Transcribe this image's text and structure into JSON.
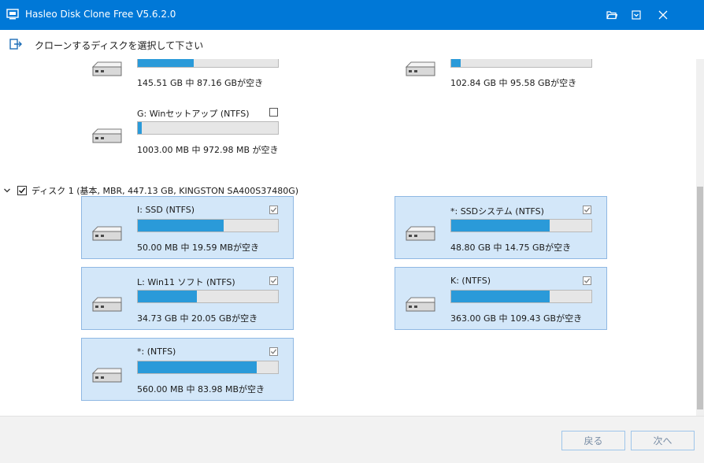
{
  "window": {
    "title": "Hasleo Disk Clone Free V5.6.2.0",
    "accent": "#0078d7",
    "icons": [
      "app-icon",
      "open-folder-icon",
      "menu-icon",
      "close-icon"
    ]
  },
  "toolbar": {
    "back_icon": "exit-icon",
    "title": "クローンするディスクを選択して下さい"
  },
  "partitions_top": [
    {
      "name": "",
      "capacity": "145.51 GB 中 87.16 GBが空き",
      "used_fraction": 0.4,
      "checked": false
    },
    {
      "name": "",
      "capacity": "102.84 GB 中 95.58 GBが空き",
      "used_fraction": 0.07,
      "checked": false
    },
    {
      "name": "G: Winセットアップ (NTFS)",
      "capacity": "1003.00 MB 中 972.98 MB が空き",
      "used_fraction": 0.03,
      "checked": false
    }
  ],
  "disk1": {
    "label": "ディスク 1 (基本, MBR, 447.13 GB,  KINGSTON SA400S37480G)",
    "checked": true,
    "partitions": [
      {
        "name": "I: SSD (NTFS)",
        "capacity": "50.00 MB 中 19.59 MBが空き",
        "used_fraction": 0.61,
        "checked": true
      },
      {
        "name": "*: SSDシステム (NTFS)",
        "capacity": "48.80 GB 中 14.75 GBが空き",
        "used_fraction": 0.7,
        "checked": true
      },
      {
        "name": "L: Win11 ソフト (NTFS)",
        "capacity": "34.73 GB 中 20.05 GBが空き",
        "used_fraction": 0.42,
        "checked": true
      },
      {
        "name": "K: (NTFS)",
        "capacity": "363.00 GB 中 109.43 GBが空き",
        "used_fraction": 0.7,
        "checked": true
      },
      {
        "name": "*: (NTFS)",
        "capacity": "560.00 MB 中 83.98 MBが空き",
        "used_fraction": 0.85,
        "checked": true
      }
    ]
  },
  "footer": {
    "back_label": "戻る",
    "next_label": "次へ"
  }
}
